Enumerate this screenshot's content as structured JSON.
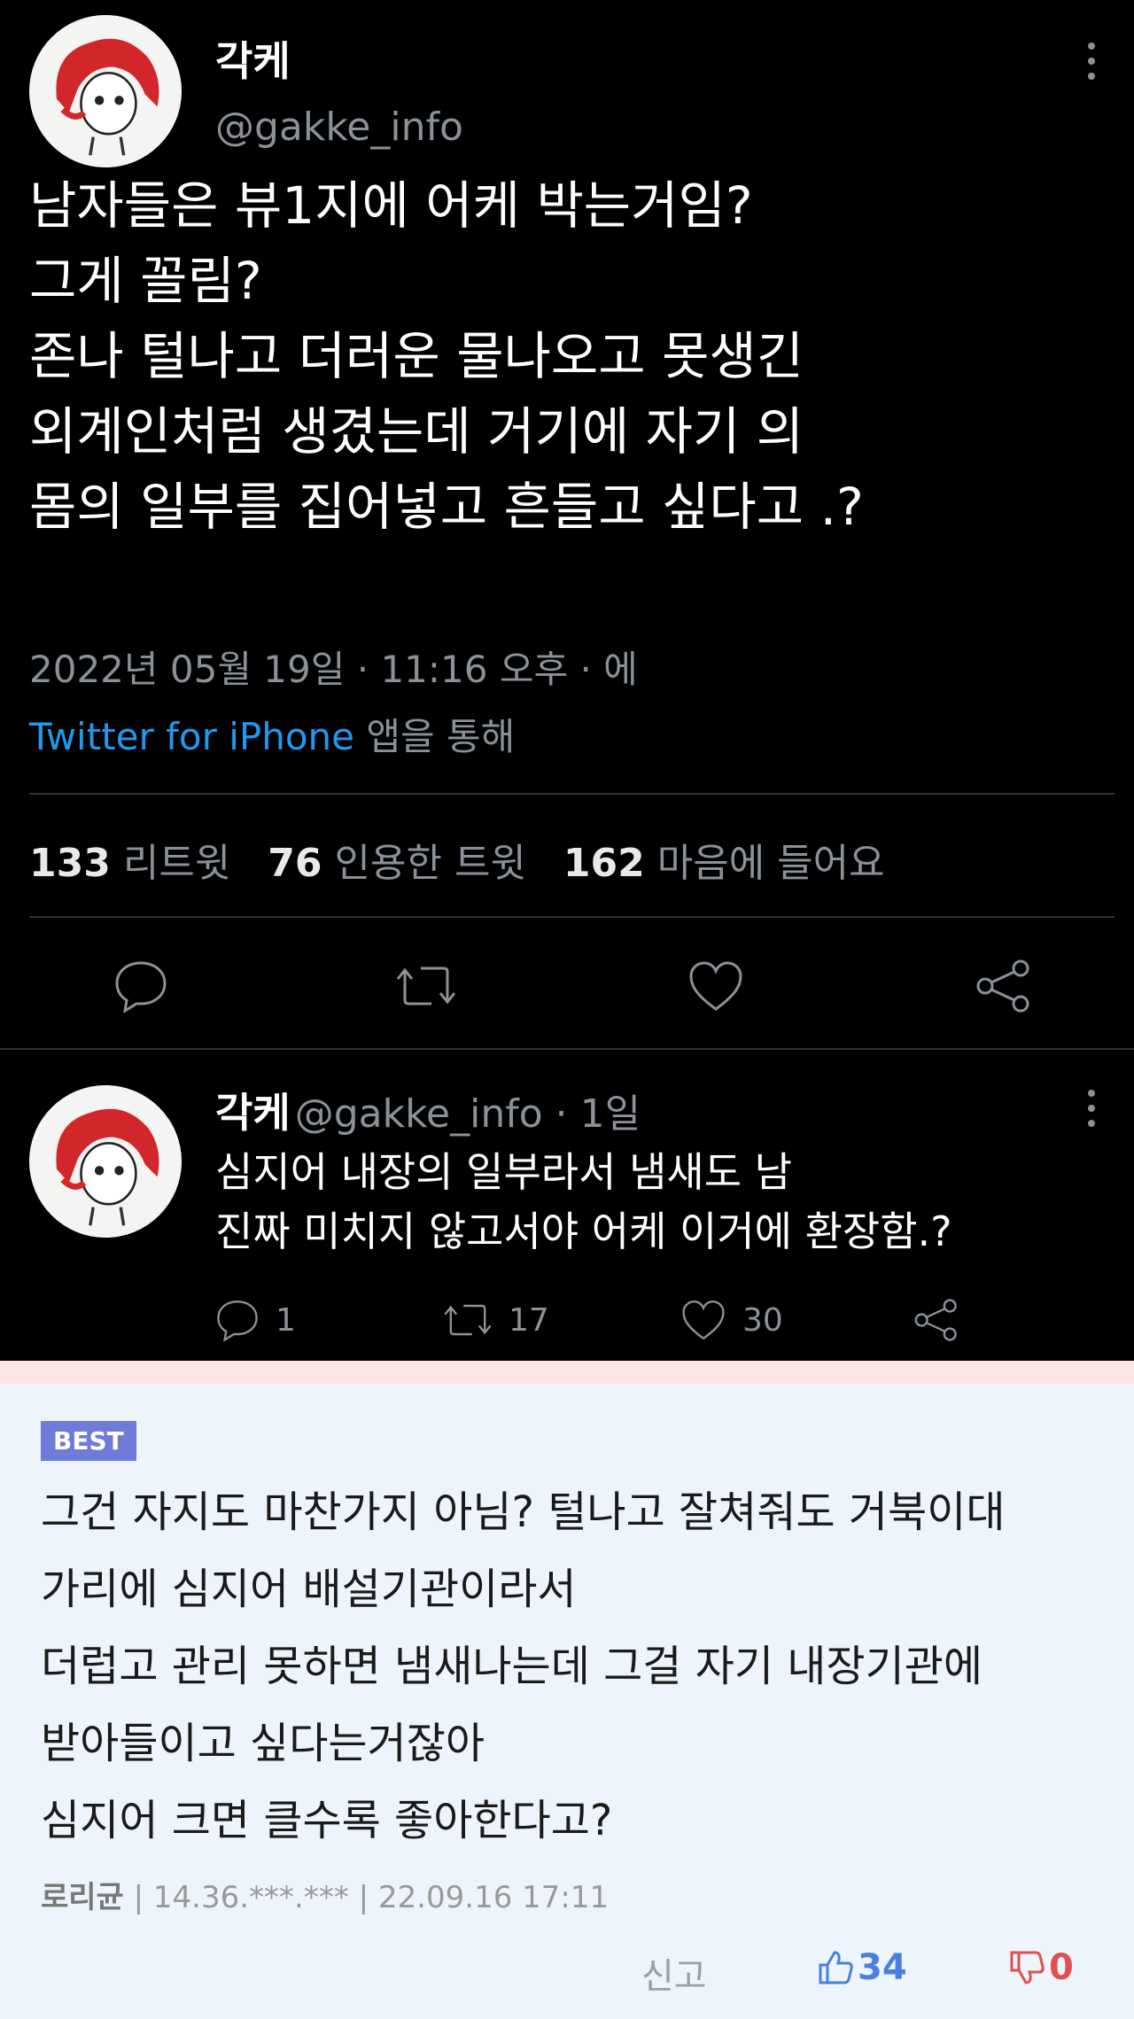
{
  "tweet": {
    "author_name": "각케",
    "author_handle": "@gakke_info",
    "text": "남자들은 뷰1지에 어케 박는거임?\n그게 꼴림?\n존나 털나고 더러운 물나오고 못생긴\n외계인처럼 생겼는데 거기에 자기 의\n몸의 일부를 집어넣고 흔들고 싶다고 .?",
    "timestamp": "2022년 05월 19일 · 11:16 오후 · 에",
    "source_app": "Twitter for iPhone",
    "source_suffix": " 앱을 통해",
    "stats": {
      "retweets_count": "133",
      "retweets_label": "리트윗",
      "quotes_count": "76",
      "quotes_label": "인용한 트윗",
      "likes_count": "162",
      "likes_label": "마음에 들어요"
    },
    "actions": [
      "reply-icon",
      "retweet-icon",
      "like-icon",
      "share-icon"
    ]
  },
  "reply": {
    "author_name": "각케",
    "author_handle": "@gakke_info · 1일",
    "text": "심지어 내장의 일부라서 냄새도 남\n진짜 미치지 않고서야 어케 이거에 환장함.?",
    "reply_count": "1",
    "retweet_count": "17",
    "like_count": "30"
  },
  "comment": {
    "badge": "BEST",
    "text": "그건 자지도 마찬가지 아님? 털나고 잘쳐줘도 거북이대\n가리에 심지어 배설기관이라서\n더럽고 관리 못하면 냄새나는데 그걸 자기 내장기관에\n받아들이고 싶다는거잖아\n심지어 크면 클수록 좋아한다고?",
    "author": "로리균",
    "ip": " | 14.36.***.*** | ",
    "datetime": "22.09.16 17:11",
    "report_label": "신고",
    "upvotes": "34",
    "downvotes": "0"
  },
  "colors": {
    "background": "#000000",
    "link": "#1d9bf0",
    "muted": "#8b9198",
    "best_badge": "#6e7bd9",
    "upvote": "#4a7fe0",
    "downvote": "#e05050"
  }
}
